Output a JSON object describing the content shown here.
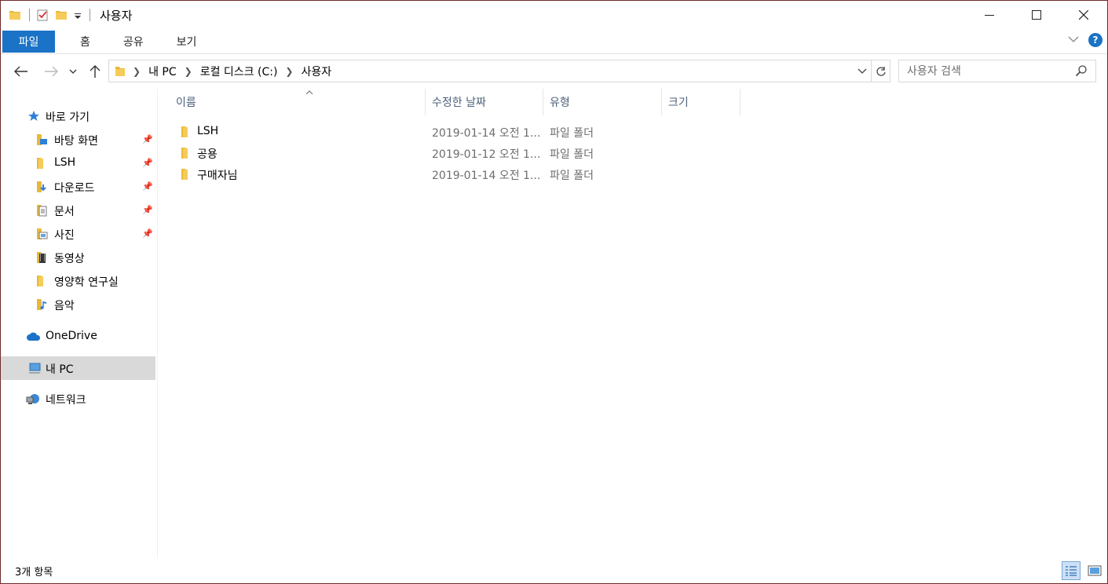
{
  "window": {
    "title": "사용자",
    "minimize": "—",
    "maximize": "☐",
    "close": "✕"
  },
  "ribbon": {
    "tabs": [
      "파일",
      "홈",
      "공유",
      "보기"
    ],
    "collapse": "﹀",
    "help": "?"
  },
  "address": {
    "crumbs": [
      "내 PC",
      "로컬 디스크 (C:)",
      "사용자"
    ],
    "search_placeholder": "사용자 검색"
  },
  "sidebar": {
    "quick_access": "바로 가기",
    "items": [
      {
        "label": "바탕 화면",
        "pinned": true,
        "icon": "desktop-folder-icon"
      },
      {
        "label": "LSH",
        "pinned": true,
        "icon": "folder-icon"
      },
      {
        "label": "다운로드",
        "pinned": true,
        "icon": "downloads-folder-icon"
      },
      {
        "label": "문서",
        "pinned": true,
        "icon": "documents-folder-icon"
      },
      {
        "label": "사진",
        "pinned": true,
        "icon": "pictures-folder-icon"
      },
      {
        "label": "동영상",
        "pinned": false,
        "icon": "videos-folder-icon"
      },
      {
        "label": "영양학 연구실",
        "pinned": false,
        "icon": "folder-icon"
      },
      {
        "label": "음악",
        "pinned": false,
        "icon": "music-folder-icon"
      }
    ],
    "onedrive": "OneDrive",
    "this_pc": "내 PC",
    "network": "네트워크"
  },
  "columns": {
    "name": "이름",
    "date": "수정한 날짜",
    "type": "유형",
    "size": "크기"
  },
  "files": [
    {
      "name": "LSH",
      "date": "2019-01-14 오전 1...",
      "type": "파일 폴더"
    },
    {
      "name": "공용",
      "date": "2019-01-12 오전 1...",
      "type": "파일 폴더"
    },
    {
      "name": "구매자님",
      "date": "2019-01-14 오전 1...",
      "type": "파일 폴더"
    }
  ],
  "status": {
    "count": "3개 항목"
  },
  "colors": {
    "accent": "#1a73c6",
    "folder": "#f0c14b",
    "selected": "#d9d9d9"
  }
}
